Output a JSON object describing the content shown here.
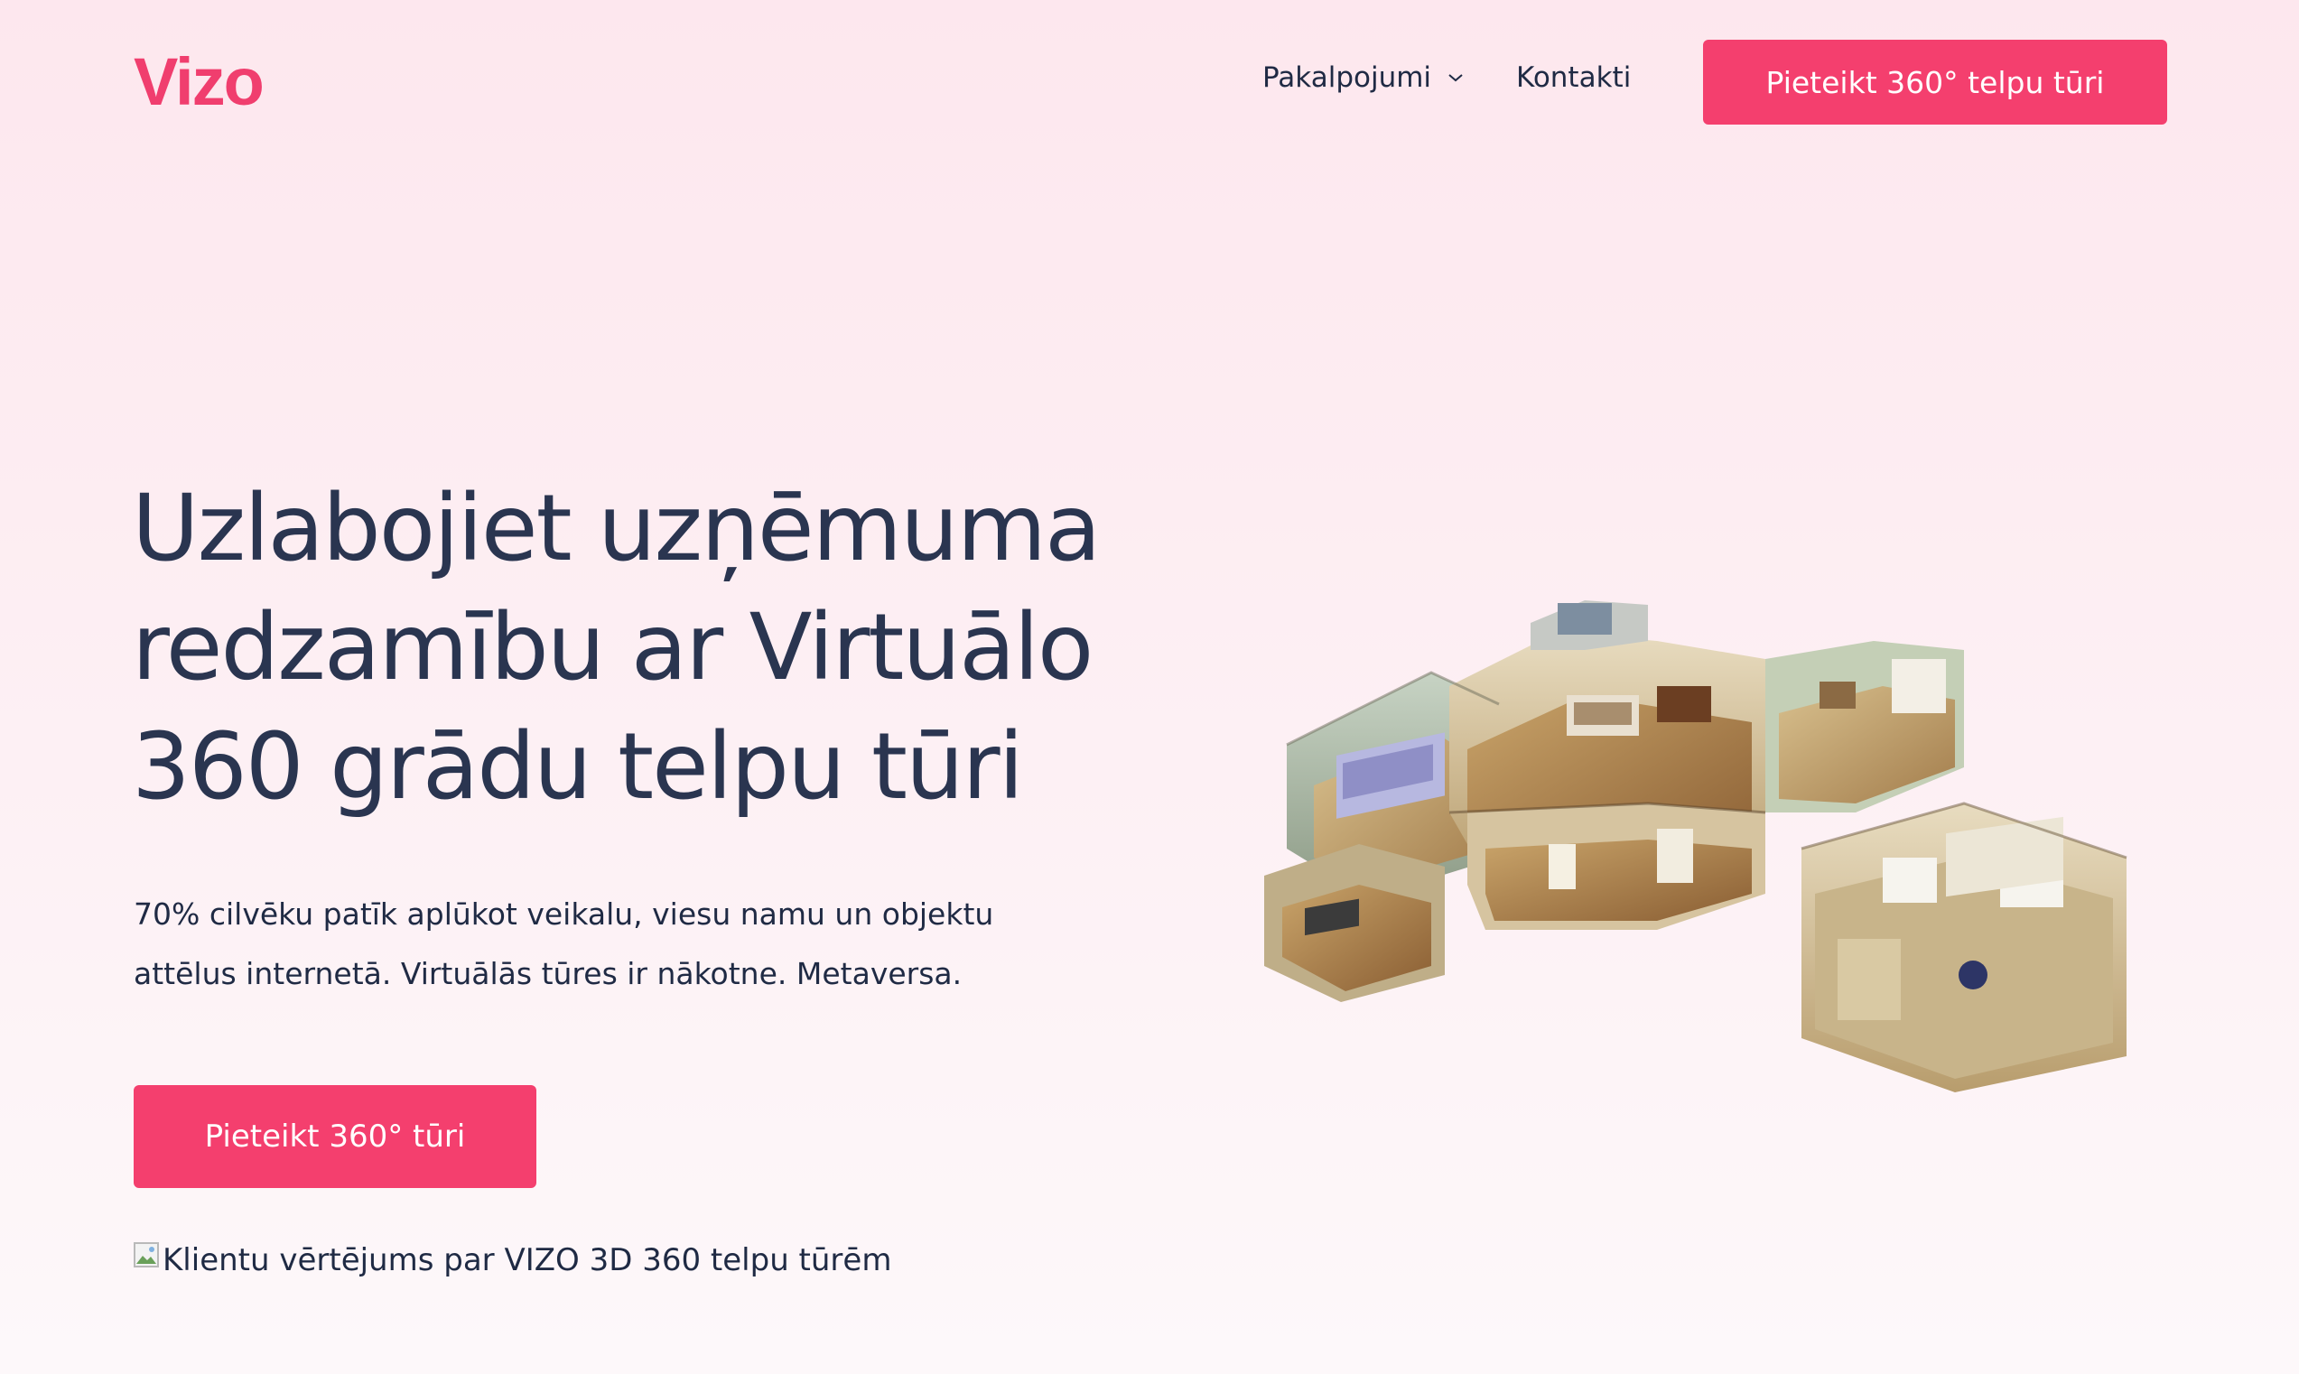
{
  "header": {
    "logo": "Vizo",
    "nav": {
      "services_label": "Pakalpojumi",
      "contacts_label": "Kontakti"
    },
    "cta_label": "Pieteikt 360° telpu tūri"
  },
  "hero": {
    "title_lines": [
      "Uzlabojiet uzņēmuma",
      "redzamību ar Virtuālo",
      "360 grādu telpu tūri"
    ],
    "subtitle_lines": [
      "70% cilvēku patīk aplūkot veikalu, viesu namu un objektu",
      "attēlus internetā. Virtuālās tūres ir nākotne. Metaversa."
    ],
    "cta_label": "Pieteikt 360° tūri",
    "image_alt": "Klientu vērtējums par VIZO 3D 360 telpu tūrēm"
  },
  "colors": {
    "brand": "#f43f6e",
    "text": "#2a3550",
    "background_top": "#fde7ee",
    "background_bottom": "#fdf8fa"
  },
  "icons": {
    "dropdown": "chevron-down-icon",
    "broken_image": "broken-image-icon"
  }
}
